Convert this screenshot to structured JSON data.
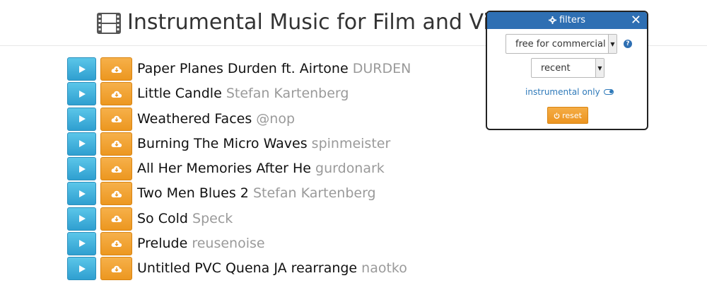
{
  "header": {
    "title": "Instrumental Music for Film and Vid",
    "icon": "film-icon"
  },
  "tracks": [
    {
      "title": "Paper Planes Durden ft. Airtone",
      "artist": "DURDEN"
    },
    {
      "title": "Little Candle",
      "artist": "Stefan Kartenberg"
    },
    {
      "title": "Weathered Faces",
      "artist": "@nop"
    },
    {
      "title": "Burning The Micro Waves",
      "artist": "spinmeister"
    },
    {
      "title": "All Her Memories After He",
      "artist": "gurdonark"
    },
    {
      "title": "Two Men Blues 2",
      "artist": "Stefan Kartenberg"
    },
    {
      "title": "So Cold",
      "artist": "Speck"
    },
    {
      "title": "Prelude",
      "artist": "reusenoise"
    },
    {
      "title": "Untitled PVC Quena JA rearrange",
      "artist": "naotko"
    }
  ],
  "track_buttons": {
    "play_icon": "play-icon",
    "download_icon": "cloud-download-icon",
    "play_color": "#35a8d8",
    "download_color": "#f0a030"
  },
  "filters": {
    "title": "filters",
    "license_value": "free for commercial u",
    "sort_value": "recent",
    "instrumental_label": "instrumental only",
    "reset_label": "reset",
    "header_color": "#2e6fb3"
  }
}
